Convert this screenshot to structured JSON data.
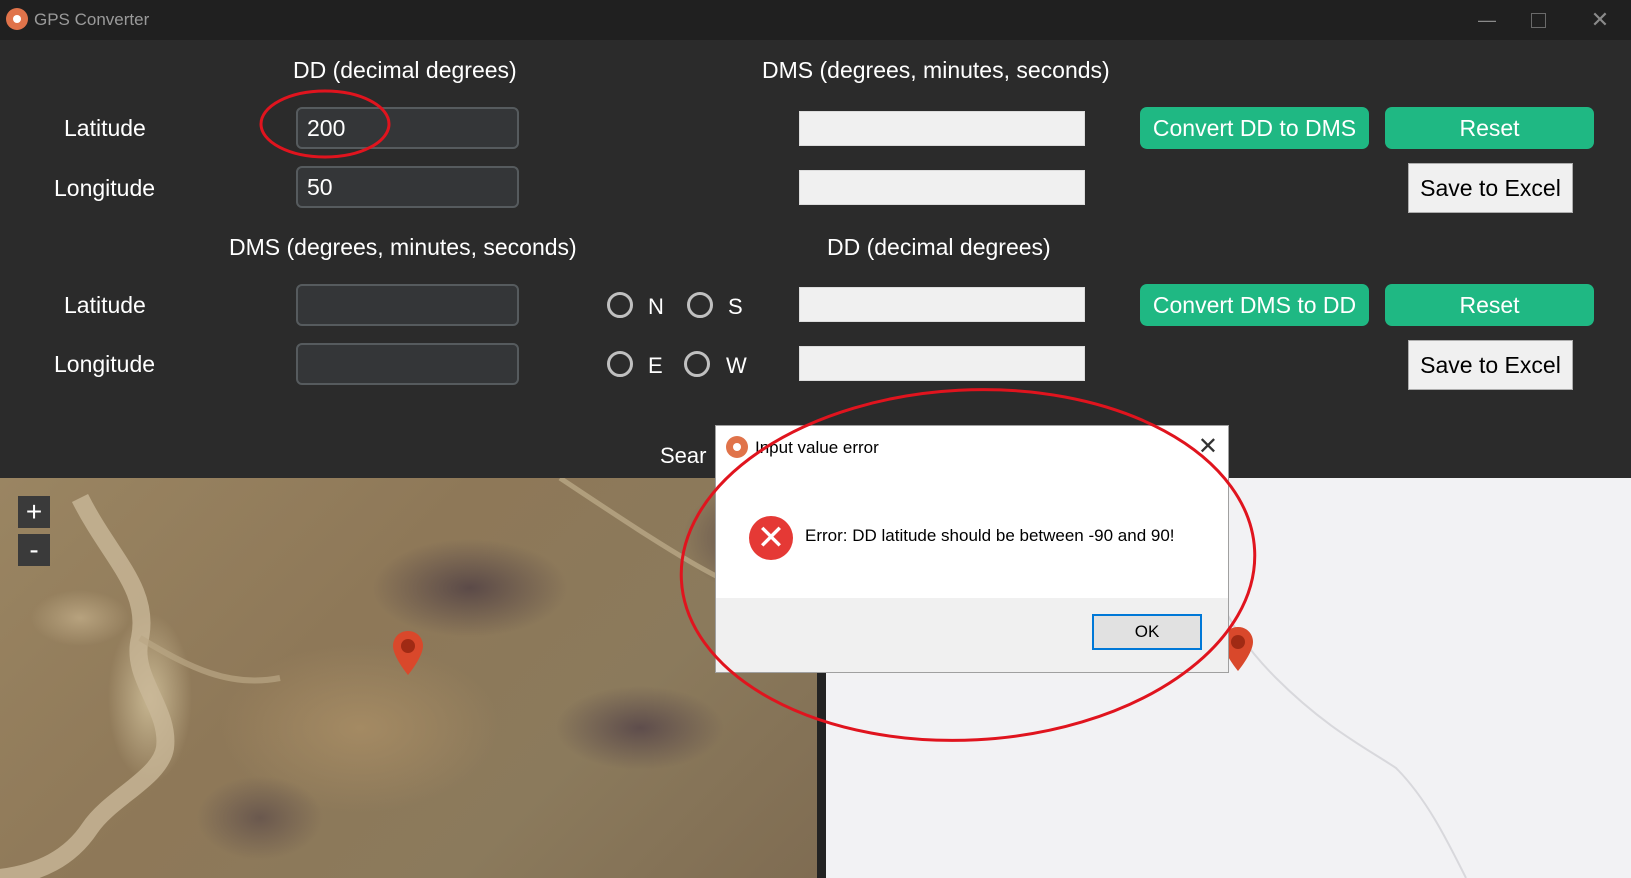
{
  "window": {
    "title": "GPS Converter",
    "icons": {
      "app": "map-pin-icon",
      "minimize": "minimize-icon",
      "maximize": "maximize-icon",
      "close": "close-icon"
    }
  },
  "dd_to_dms": {
    "input_heading": "DD (decimal degrees)",
    "output_heading": "DMS (degrees, minutes, seconds)",
    "latitude_label": "Latitude",
    "longitude_label": "Longitude",
    "latitude_value": "200",
    "longitude_value": "50",
    "latitude_output": "",
    "longitude_output": "",
    "convert_label": "Convert DD to DMS",
    "reset_label": "Reset",
    "save_label": "Save to Excel"
  },
  "dms_to_dd": {
    "input_heading": "DMS (degrees, minutes, seconds)",
    "output_heading": "DD (decimal degrees)",
    "latitude_label": "Latitude",
    "longitude_label": "Longitude",
    "latitude_value": "",
    "longitude_value": "",
    "radio_n": "N",
    "radio_s": "S",
    "radio_e": "E",
    "radio_w": "W",
    "latitude_output": "",
    "longitude_output": "",
    "convert_label": "Convert DMS to DD",
    "reset_label": "Reset",
    "save_label": "Save to Excel"
  },
  "search": {
    "label_visible": "Sear"
  },
  "map": {
    "zoom_in": "+",
    "zoom_out": "-",
    "marker_icon": "map-marker-icon"
  },
  "dialog": {
    "title": "Input value error",
    "message": "Error: DD latitude should be between -90 and 90!",
    "ok_label": "OK",
    "error_icon": "error-icon",
    "close_icon": "close-icon"
  },
  "colors": {
    "accent_green": "#1fb883",
    "annotation_red": "#e0141e",
    "marker_red": "#d9482b",
    "error_red": "#e53935"
  }
}
